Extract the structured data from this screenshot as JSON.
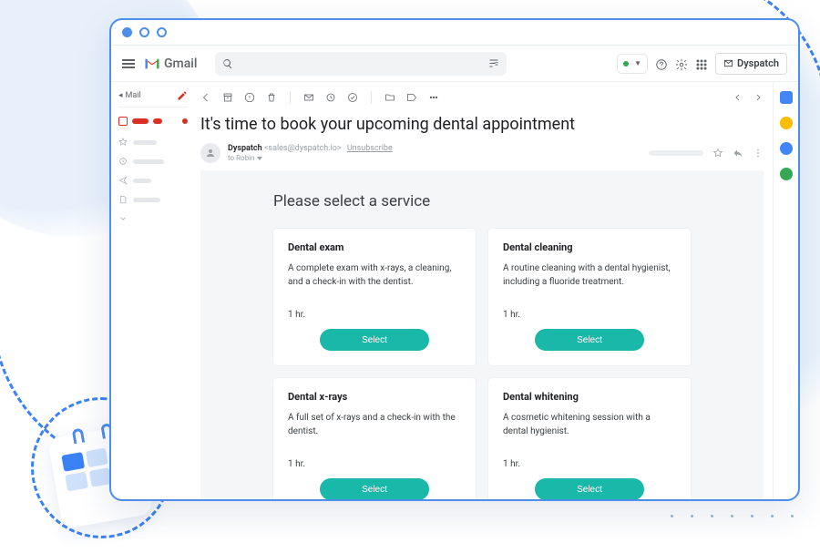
{
  "app": {
    "name": "Gmail",
    "addon_button": "Dyspatch"
  },
  "sidebar": {
    "mail_label": "Mail"
  },
  "email": {
    "subject": "It's time to book your upcoming dental appointment",
    "sender_name": "Dyspatch",
    "sender_email": "<sales@dyspatch.io>",
    "unsubscribe": "Unsubscribe",
    "to_line": "to Robin",
    "selector_heading": "Please select a service",
    "services": [
      {
        "title": "Dental exam",
        "desc": "A complete exam with x-rays, a cleaning, and a check-in with the dentist.",
        "duration": "1 hr.",
        "cta": "Select"
      },
      {
        "title": "Dental cleaning",
        "desc": "A routine cleaning with a dental hygienist, including a fluoride treatment.",
        "duration": "1 hr.",
        "cta": "Select"
      },
      {
        "title": "Dental x-rays",
        "desc": "A full set of x-rays and a check-in with the dentist.",
        "duration": "1 hr.",
        "cta": "Select"
      },
      {
        "title": "Dental whitening",
        "desc": "A cosmetic whitening session with a dental hygienist.",
        "duration": "1 hr.",
        "cta": "Select"
      }
    ]
  }
}
